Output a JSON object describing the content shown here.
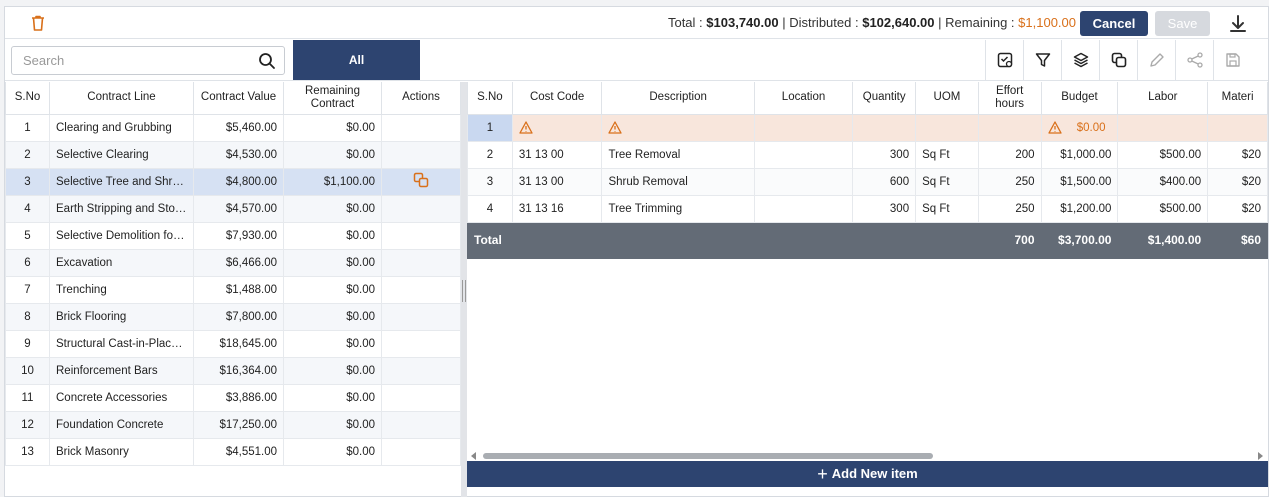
{
  "header": {
    "total_label": "Total :",
    "total_value": "$103,740.00",
    "distributed_label": "Distributed :",
    "distributed_value": "$102,640.00",
    "remaining_label": "Remaining :",
    "remaining_value": "$1,100.00",
    "cancel_label": "Cancel",
    "save_label": "Save"
  },
  "search": {
    "placeholder": "Search"
  },
  "tab_all": "All",
  "icons": [
    "trash-icon",
    "download-icon",
    "search-icon",
    "checklist-icon",
    "filter-icon",
    "layers-icon",
    "copy-icon",
    "pencil-icon",
    "share-icon",
    "save-disk-icon",
    "warning-icon",
    "plus-icon"
  ],
  "colors": {
    "primary": "#2d4470",
    "remaining": "#d9701a",
    "warning": "#d9701a",
    "selected_row": "#d6e1f3",
    "total_row": "#636b76"
  },
  "left_table": {
    "columns": [
      "S.No",
      "Contract Line",
      "Contract Value",
      "Remaining Contract",
      "Actions"
    ],
    "rows": [
      {
        "sno": "1",
        "line": "Clearing and Grubbing",
        "value": "$5,460.00",
        "remaining": "$0.00"
      },
      {
        "sno": "2",
        "line": "Selective Clearing",
        "value": "$4,530.00",
        "remaining": "$0.00"
      },
      {
        "sno": "3",
        "line": "Selective Tree and Shrub ...",
        "value": "$4,800.00",
        "remaining": "$1,100.00"
      },
      {
        "sno": "4",
        "line": "Earth Stripping and Stock...",
        "value": "$4,570.00",
        "remaining": "$0.00"
      },
      {
        "sno": "5",
        "line": "Selective Demolition for ...",
        "value": "$7,930.00",
        "remaining": "$0.00"
      },
      {
        "sno": "6",
        "line": "Excavation",
        "value": "$6,466.00",
        "remaining": "$0.00"
      },
      {
        "sno": "7",
        "line": "Trenching",
        "value": "$1,488.00",
        "remaining": "$0.00"
      },
      {
        "sno": "8",
        "line": "Brick Flooring",
        "value": "$7,800.00",
        "remaining": "$0.00"
      },
      {
        "sno": "9",
        "line": "Structural Cast-in-Place ...",
        "value": "$18,645.00",
        "remaining": "$0.00"
      },
      {
        "sno": "10",
        "line": "Reinforcement Bars",
        "value": "$16,364.00",
        "remaining": "$0.00"
      },
      {
        "sno": "11",
        "line": "Concrete Accessories",
        "value": "$3,886.00",
        "remaining": "$0.00"
      },
      {
        "sno": "12",
        "line": "Foundation Concrete",
        "value": "$17,250.00",
        "remaining": "$0.00"
      },
      {
        "sno": "13",
        "line": "Brick Masonry",
        "value": "$4,551.00",
        "remaining": "$0.00"
      }
    ]
  },
  "right_table": {
    "columns": [
      "S.No",
      "Cost Code",
      "Description",
      "Location",
      "Quantity",
      "UOM",
      "Effort hours",
      "Budget",
      "Labor",
      "Materi"
    ],
    "warning_row": {
      "sno": "1",
      "budget": "$0.00"
    },
    "rows": [
      {
        "sno": "2",
        "code": "31 13 00",
        "desc": "Tree Removal",
        "location": "",
        "qty": "300",
        "uom": "Sq Ft",
        "effort": "200",
        "budget": "$1,000.00",
        "labor": "$500.00",
        "material": "$20"
      },
      {
        "sno": "3",
        "code": "31 13 00",
        "desc": "Shrub Removal",
        "location": "",
        "qty": "600",
        "uom": "Sq Ft",
        "effort": "250",
        "budget": "$1,500.00",
        "labor": "$400.00",
        "material": "$20"
      },
      {
        "sno": "4",
        "code": "31 13 16",
        "desc": "Tree Trimming",
        "location": "",
        "qty": "300",
        "uom": "Sq Ft",
        "effort": "250",
        "budget": "$1,200.00",
        "labor": "$500.00",
        "material": "$20"
      }
    ],
    "total": {
      "label": "Total",
      "effort": "700",
      "budget": "$3,700.00",
      "labor": "$1,400.00",
      "material": "$60"
    }
  },
  "add_item_label": "Add New item"
}
